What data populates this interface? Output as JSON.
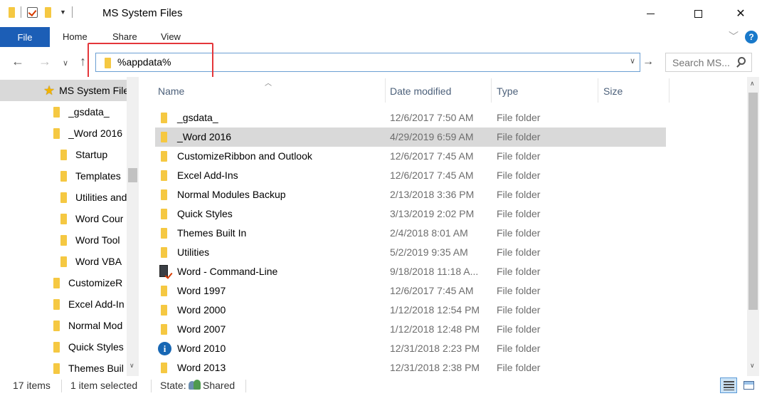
{
  "window": {
    "title": "MS System Files",
    "controls": {
      "minimize": "minimize",
      "maximize": "maximize",
      "close": "✕"
    }
  },
  "ribbon": {
    "tabs": [
      "File",
      "Home",
      "Share",
      "View"
    ],
    "help": "?"
  },
  "address": {
    "value": "%appdata%",
    "highlight_color": "#e4363a"
  },
  "search": {
    "placeholder": "Search MS..."
  },
  "nav": {
    "items": [
      {
        "label": "MS System Files",
        "icon": "star-icon"
      },
      {
        "label": "_gsdata_",
        "icon": "folder-icon"
      },
      {
        "label": "_Word 2016",
        "icon": "folder-icon"
      },
      {
        "label": "Startup",
        "icon": "folder-icon"
      },
      {
        "label": "Templates",
        "icon": "folder-icon"
      },
      {
        "label": "Utilities and",
        "icon": "folder-icon"
      },
      {
        "label": "Word Cour",
        "icon": "folder-icon"
      },
      {
        "label": "Word Tool",
        "icon": "folder-icon"
      },
      {
        "label": "Word VBA",
        "icon": "folder-icon"
      },
      {
        "label": "CustomizeR",
        "icon": "folder-icon"
      },
      {
        "label": "Excel Add-In",
        "icon": "folder-icon"
      },
      {
        "label": "Normal Mod",
        "icon": "folder-icon"
      },
      {
        "label": "Quick Styles",
        "icon": "folder-icon"
      },
      {
        "label": "Themes Buil",
        "icon": "folder-icon"
      }
    ]
  },
  "columns": {
    "name": "Name",
    "date": "Date modified",
    "type": "Type",
    "size": "Size"
  },
  "files": [
    {
      "name": "_gsdata_",
      "date": "12/6/2017 7:50 AM",
      "type": "File folder",
      "icon": "folder-icon"
    },
    {
      "name": "_Word 2016",
      "date": "4/29/2019 6:59 AM",
      "type": "File folder",
      "icon": "folder-icon"
    },
    {
      "name": "CustomizeRibbon and Outlook",
      "date": "12/6/2017 7:45 AM",
      "type": "File folder",
      "icon": "folder-icon"
    },
    {
      "name": "Excel Add-Ins",
      "date": "12/6/2017 7:45 AM",
      "type": "File folder",
      "icon": "folder-icon"
    },
    {
      "name": "Normal Modules Backup",
      "date": "2/13/2018 3:36 PM",
      "type": "File folder",
      "icon": "folder-icon"
    },
    {
      "name": "Quick Styles",
      "date": "3/13/2019 2:02 PM",
      "type": "File folder",
      "icon": "folder-icon"
    },
    {
      "name": "Themes Built In",
      "date": "2/4/2018 8:01 AM",
      "type": "File folder",
      "icon": "folder-icon"
    },
    {
      "name": "Utilities",
      "date": "5/2/2019 9:35 AM",
      "type": "File folder",
      "icon": "folder-icon"
    },
    {
      "name": "Word - Command-Line",
      "date": "9/18/2018 11:18 A...",
      "type": "File folder",
      "icon": "command-line-icon"
    },
    {
      "name": "Word 1997",
      "date": "12/6/2017 7:45 AM",
      "type": "File folder",
      "icon": "folder-icon"
    },
    {
      "name": "Word 2000",
      "date": "1/12/2018 12:54 PM",
      "type": "File folder",
      "icon": "folder-icon"
    },
    {
      "name": "Word 2007",
      "date": "1/12/2018 12:48 PM",
      "type": "File folder",
      "icon": "folder-icon"
    },
    {
      "name": "Word 2010",
      "date": "12/31/2018 2:23 PM",
      "type": "File folder",
      "icon": "info-icon"
    },
    {
      "name": "Word 2013",
      "date": "12/31/2018 2:38 PM",
      "type": "File folder",
      "icon": "folder-icon"
    }
  ],
  "status": {
    "count": "17 items",
    "selected": "1 item selected",
    "state_label": "State:",
    "state_value": "Shared"
  },
  "colors": {
    "accent": "#1c5eb6",
    "selection": "#d9d9d9",
    "header_text": "#4c607a"
  }
}
